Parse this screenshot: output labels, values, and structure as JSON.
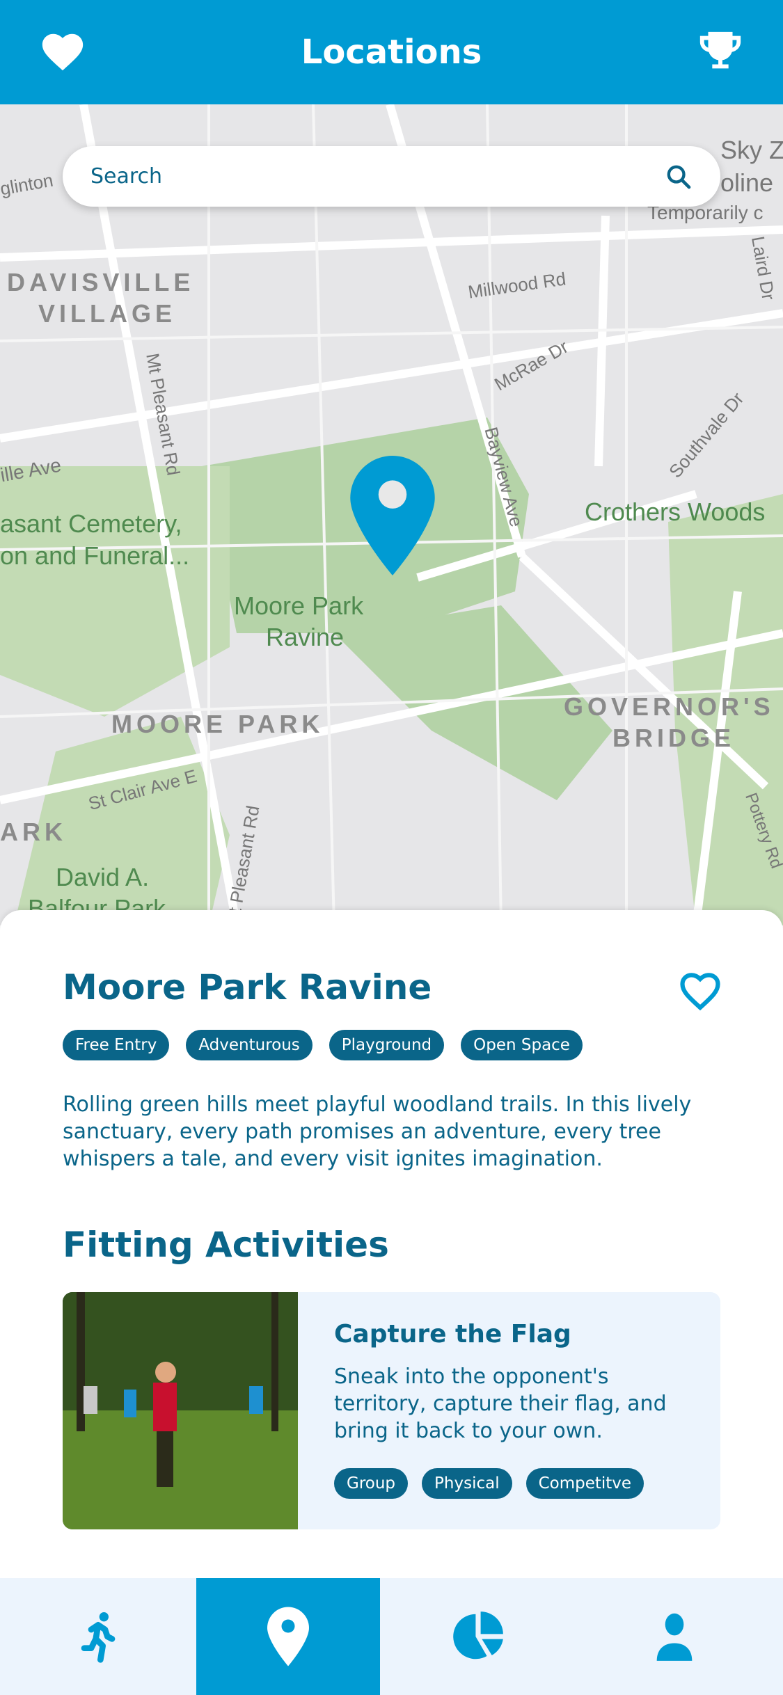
{
  "header": {
    "title": "Locations",
    "left_icon": "heart-icon",
    "right_icon": "trophy-icon"
  },
  "search": {
    "placeholder": "Search"
  },
  "map": {
    "labels": [
      "DAVISVILLE",
      "VILLAGE",
      "Millwood Rd",
      "McRae Dr",
      "Mt Pleasant Rd",
      "Bayview Ave",
      "Southvale Dr",
      "ille Ave",
      "asant Cemetery,",
      "on and Funeral...",
      "Moore Park",
      "Ravine",
      "Crothers Woods",
      "MOORE PARK",
      "GOVERNOR'S",
      "BRIDGE",
      "St Clair Ave E",
      "Mt Pleasant Rd",
      "ARK",
      "David A.",
      "Balfour Park",
      "Sky Z",
      "oline",
      "Temporarily c",
      "Laird Dr",
      "glinton",
      "Pottery Rd"
    ],
    "pin_color": "#009bd3"
  },
  "location": {
    "name": "Moore Park Ravine",
    "favorite": false,
    "tags": [
      "Free Entry",
      "Adventurous",
      "Playground",
      "Open Space"
    ],
    "description": "Rolling green hills meet playful woodland trails. In this lively sanctuary, every path promises an adventure, every tree whispers a tale, and every visit ignites imagination."
  },
  "activities": {
    "heading": "Fitting Activities",
    "items": [
      {
        "title": "Capture the Flag",
        "description": "Sneak into the opponent's territory, capture their flag, and bring it back to your own.",
        "tags": [
          "Group",
          "Physical",
          "Competitve"
        ]
      }
    ]
  },
  "nav": {
    "active": "locations",
    "items": [
      "activities",
      "locations",
      "stats",
      "profile"
    ]
  },
  "colors": {
    "primary": "#009bd3",
    "text": "#0a6589",
    "light": "#ecf4fd"
  }
}
